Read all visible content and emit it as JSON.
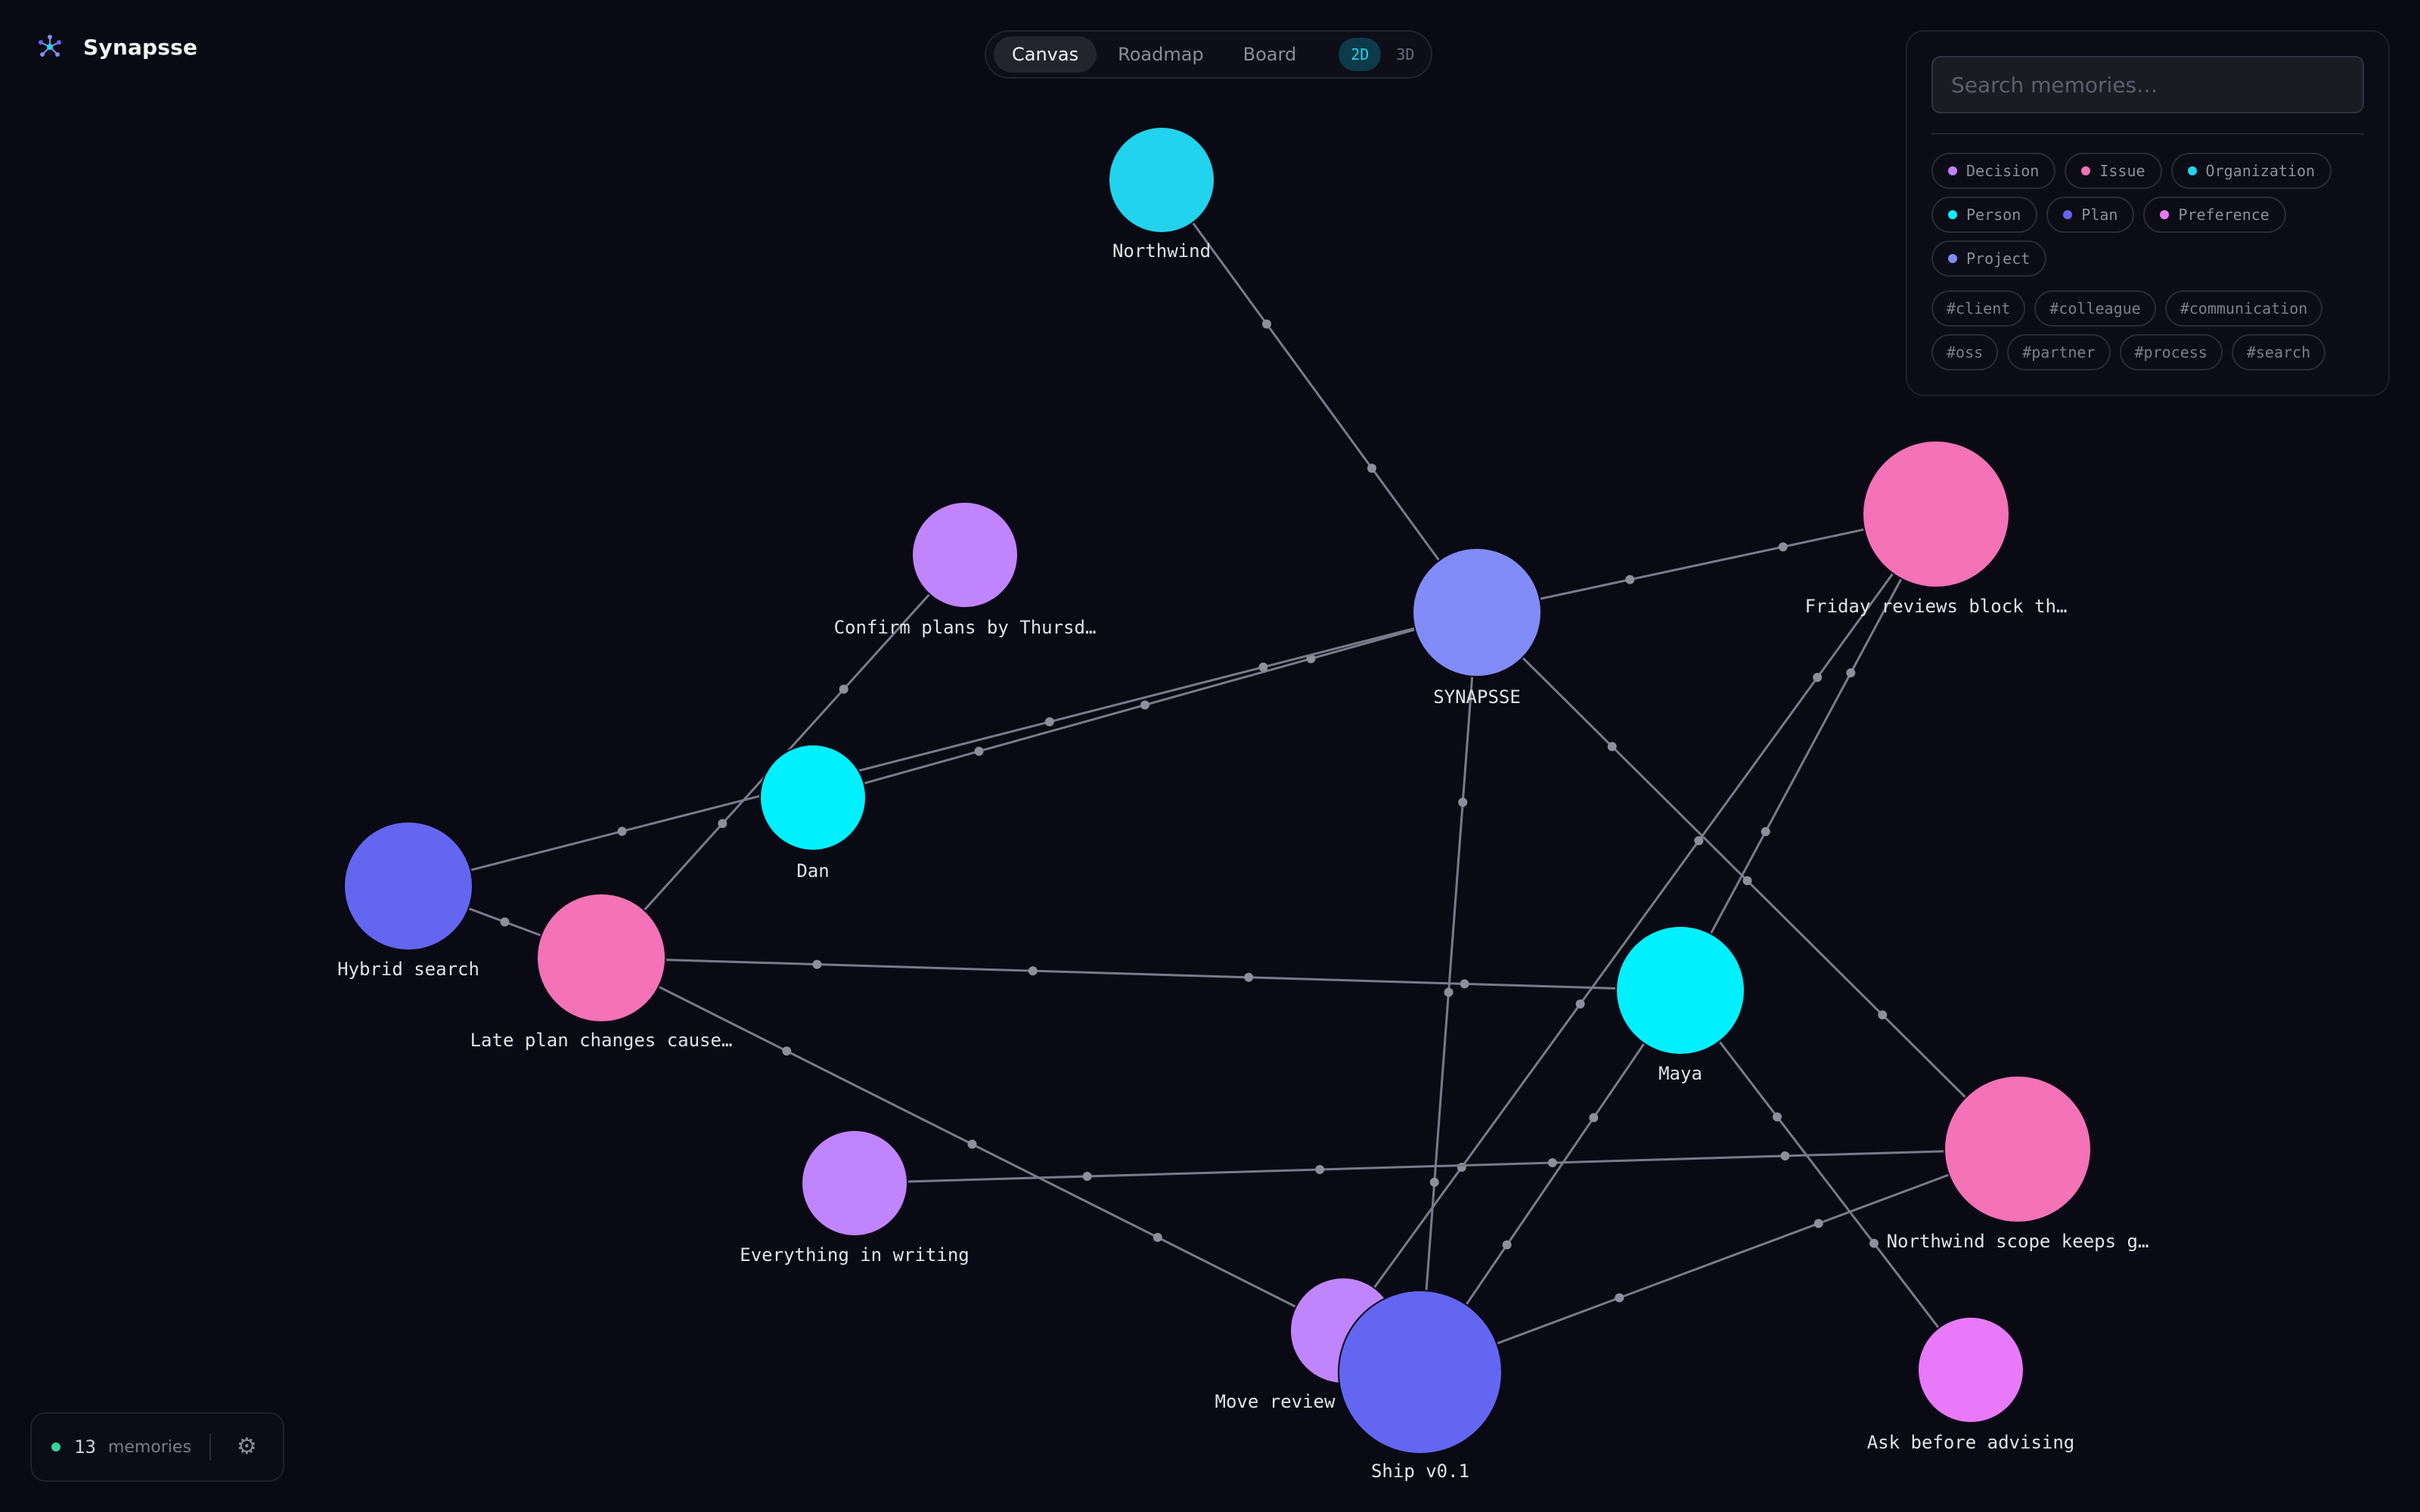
{
  "app": {
    "name": "Synapsse",
    "logo_icon": "neural-network-icon"
  },
  "view_switch": {
    "tabs": [
      {
        "label": "Canvas",
        "active": true
      },
      {
        "label": "Roadmap",
        "active": false
      },
      {
        "label": "Board",
        "active": false
      }
    ],
    "dims": [
      {
        "label": "2D",
        "active": true
      },
      {
        "label": "3D",
        "active": false
      }
    ]
  },
  "filters": {
    "search_placeholder": "Search memories…",
    "types": [
      {
        "label": "Decision",
        "color": "#c084fc"
      },
      {
        "label": "Issue",
        "color": "#f472b6"
      },
      {
        "label": "Organization",
        "color": "#22d3ee"
      },
      {
        "label": "Person",
        "color": "#00f0ff"
      },
      {
        "label": "Plan",
        "color": "#6366f1"
      },
      {
        "label": "Preference",
        "color": "#e879f9"
      },
      {
        "label": "Project",
        "color": "#818cf8"
      }
    ],
    "tags": [
      "#client",
      "#colleague",
      "#communication",
      "#oss",
      "#partner",
      "#process",
      "#search"
    ]
  },
  "graph": {
    "nodes": [
      {
        "id": "northwind",
        "label": "Northwind",
        "type": "Organization",
        "color": "#22d3ee"
      },
      {
        "id": "confirm",
        "label": "Confirm plans by Thursd…",
        "type": "Decision",
        "color": "#c084fc"
      },
      {
        "id": "synapsse",
        "label": "SYNAPSSE",
        "type": "Project",
        "color": "#818cf8"
      },
      {
        "id": "friday",
        "label": "Friday reviews block th…",
        "type": "Issue",
        "color": "#f472b6"
      },
      {
        "id": "dan",
        "label": "Dan",
        "type": "Person",
        "color": "#00f0ff"
      },
      {
        "id": "hybrid",
        "label": "Hybrid search",
        "type": "Plan",
        "color": "#6366f1"
      },
      {
        "id": "late",
        "label": "Late plan changes cause…",
        "type": "Issue",
        "color": "#f472b6"
      },
      {
        "id": "maya",
        "label": "Maya",
        "type": "Person",
        "color": "#00f0ff"
      },
      {
        "id": "writing",
        "label": "Everything in writing",
        "type": "Decision",
        "color": "#c084fc"
      },
      {
        "id": "scope",
        "label": "Northwind scope keeps g…",
        "type": "Issue",
        "color": "#f472b6"
      },
      {
        "id": "move",
        "label": "Move review",
        "type": "Decision",
        "color": "#c084fc"
      },
      {
        "id": "ship",
        "label": "Ship v0.1",
        "type": "Plan",
        "color": "#6366f1"
      },
      {
        "id": "ask",
        "label": "Ask before advising",
        "type": "Preference",
        "color": "#e879f9"
      }
    ],
    "edges": [
      [
        "northwind",
        "synapsse"
      ],
      [
        "confirm",
        "late"
      ],
      [
        "synapsse",
        "dan"
      ],
      [
        "synapsse",
        "hybrid"
      ],
      [
        "synapsse",
        "friday"
      ],
      [
        "synapsse",
        "scope"
      ],
      [
        "synapsse",
        "ship"
      ],
      [
        "friday",
        "maya"
      ],
      [
        "friday",
        "move"
      ],
      [
        "hybrid",
        "late"
      ],
      [
        "late",
        "maya"
      ],
      [
        "late",
        "move"
      ],
      [
        "writing",
        "scope"
      ],
      [
        "maya",
        "ship"
      ],
      [
        "maya",
        "ask"
      ],
      [
        "scope",
        "ship"
      ]
    ]
  },
  "status": {
    "count": "13",
    "label": "memories",
    "live_color": "#34d399",
    "settings_icon": "gear-icon"
  }
}
